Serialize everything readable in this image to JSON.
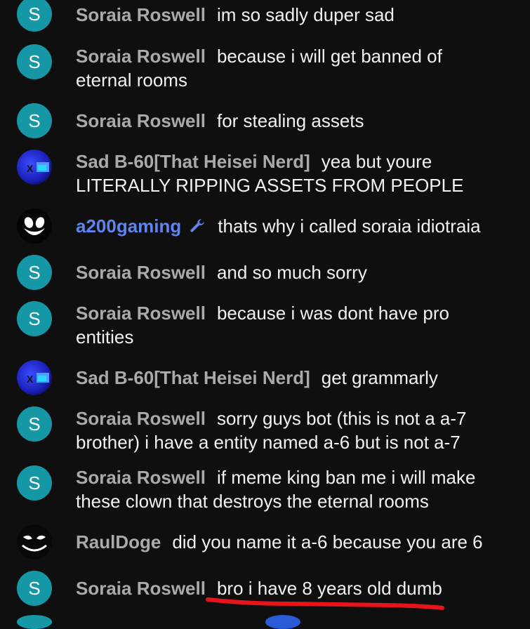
{
  "messages": [
    {
      "author": "Soraia Roswell",
      "avatar": "S",
      "text": "im so sadly duper sad"
    },
    {
      "author": "Soraia Roswell",
      "avatar": "S",
      "text": "because i will get banned of eternal rooms"
    },
    {
      "author": "Soraia Roswell",
      "avatar": "S",
      "text": "for stealing assets"
    },
    {
      "author": "Sad B-60[That Heisei Nerd]",
      "avatar": "",
      "text": "yea but youre LITERALLY RIPPING ASSETS FROM PEOPLE"
    },
    {
      "author": "a200gaming",
      "avatar": "",
      "text": "thats why i called soraia idiotraia"
    },
    {
      "author": "Soraia Roswell",
      "avatar": "S",
      "text": "and so much sorry"
    },
    {
      "author": "Soraia Roswell",
      "avatar": "S",
      "text": "because i was dont have pro entities"
    },
    {
      "author": "Sad B-60[That Heisei Nerd]",
      "avatar": "",
      "text": "get grammarly"
    },
    {
      "author": "Soraia Roswell",
      "avatar": "S",
      "text": "sorry guys bot (this is not a a-7 brother) i have a entity named a-6 but is not a-7"
    },
    {
      "author": "Soraia Roswell",
      "avatar": "S",
      "text": "if meme king ban me i will make these clown that destroys the eternal rooms"
    },
    {
      "author": "RaulDoge",
      "avatar": "",
      "text": "did you name it a-6 because you are 6"
    },
    {
      "author": "Soraia Roswell",
      "avatar": "S",
      "text": "bro i have 8 years old dumb"
    }
  ],
  "colors": {
    "background": "#0f0f0f",
    "author": "#aaaaaa",
    "moderator": "#5e84f1",
    "avatar_teal": "#1597a6",
    "underline": "#e8141c"
  },
  "icons": {
    "moderator_badge": "wrench-icon"
  }
}
